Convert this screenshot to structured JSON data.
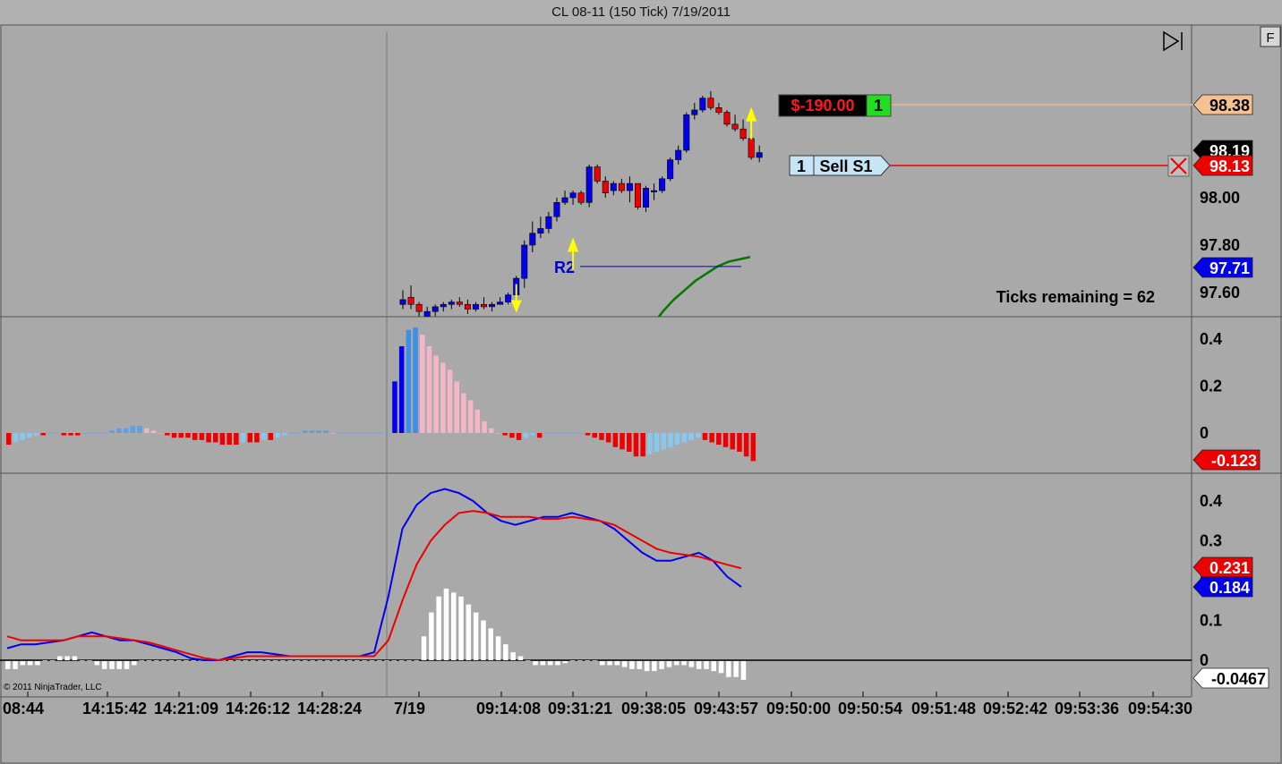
{
  "window": {
    "title": "CL 08-11 (150 Tick)  7/19/2011"
  },
  "toolbar": {
    "f_button": "F"
  },
  "position": {
    "pnl": "$-190.00",
    "qty": "1"
  },
  "order": {
    "qty": "1",
    "label": "Sell S1"
  },
  "status": {
    "ticks_remaining": "Ticks remaining = 62"
  },
  "copyright": "© 2011 NinjaTrader, LLC",
  "colors": {
    "background": "#a9a9a9",
    "bull": "#0000ee",
    "bear": "#ee0000",
    "sma": "#007a00"
  },
  "chart_data": [
    {
      "type": "candlestick",
      "panel": "price",
      "y_ticks": [
        "98.00",
        "97.80",
        "97.60"
      ],
      "ylim": [
        97.49,
        98.5
      ],
      "candles": [
        {
          "o": 97.55,
          "h": 97.61,
          "l": 97.53,
          "c": 97.57
        },
        {
          "o": 97.58,
          "h": 97.63,
          "l": 97.53,
          "c": 97.55
        },
        {
          "o": 97.55,
          "h": 97.56,
          "l": 97.5,
          "c": 97.52
        },
        {
          "o": 97.5,
          "h": 97.54,
          "l": 97.48,
          "c": 97.52
        },
        {
          "o": 97.52,
          "h": 97.55,
          "l": 97.5,
          "c": 97.54
        },
        {
          "o": 97.54,
          "h": 97.56,
          "l": 97.52,
          "c": 97.55
        },
        {
          "o": 97.55,
          "h": 97.57,
          "l": 97.53,
          "c": 97.56
        },
        {
          "o": 97.56,
          "h": 97.58,
          "l": 97.54,
          "c": 97.55
        },
        {
          "o": 97.55,
          "h": 97.57,
          "l": 97.51,
          "c": 97.53
        },
        {
          "o": 97.53,
          "h": 97.56,
          "l": 97.52,
          "c": 97.55
        },
        {
          "o": 97.55,
          "h": 97.58,
          "l": 97.53,
          "c": 97.54
        },
        {
          "o": 97.54,
          "h": 97.56,
          "l": 97.52,
          "c": 97.55
        },
        {
          "o": 97.55,
          "h": 97.58,
          "l": 97.55,
          "c": 97.56
        },
        {
          "o": 97.56,
          "h": 97.6,
          "l": 97.55,
          "c": 97.59
        },
        {
          "o": 97.59,
          "h": 97.67,
          "l": 97.59,
          "c": 97.66
        },
        {
          "o": 97.66,
          "h": 97.82,
          "l": 97.62,
          "c": 97.8
        },
        {
          "o": 97.8,
          "h": 97.9,
          "l": 97.77,
          "c": 97.85
        },
        {
          "o": 97.85,
          "h": 97.92,
          "l": 97.83,
          "c": 97.87
        },
        {
          "o": 97.87,
          "h": 97.94,
          "l": 97.85,
          "c": 97.92
        },
        {
          "o": 97.92,
          "h": 98.0,
          "l": 97.9,
          "c": 97.98
        },
        {
          "o": 97.98,
          "h": 98.03,
          "l": 97.97,
          "c": 98.0
        },
        {
          "o": 98.0,
          "h": 98.03,
          "l": 97.97,
          "c": 98.02
        },
        {
          "o": 98.02,
          "h": 98.03,
          "l": 97.97,
          "c": 97.98
        },
        {
          "o": 97.98,
          "h": 98.14,
          "l": 97.96,
          "c": 98.13
        },
        {
          "o": 98.13,
          "h": 98.14,
          "l": 98.06,
          "c": 98.07
        },
        {
          "o": 98.07,
          "h": 98.09,
          "l": 98.0,
          "c": 98.02
        },
        {
          "o": 98.03,
          "h": 98.07,
          "l": 98.01,
          "c": 98.06
        },
        {
          "o": 98.06,
          "h": 98.08,
          "l": 98.02,
          "c": 98.03
        },
        {
          "o": 98.03,
          "h": 98.09,
          "l": 97.98,
          "c": 98.06
        },
        {
          "o": 98.06,
          "h": 98.06,
          "l": 97.95,
          "c": 97.96
        },
        {
          "o": 97.96,
          "h": 98.05,
          "l": 97.94,
          "c": 98.04
        },
        {
          "o": 98.03,
          "h": 98.06,
          "l": 97.99,
          "c": 98.03
        },
        {
          "o": 98.03,
          "h": 98.09,
          "l": 98.02,
          "c": 98.08
        },
        {
          "o": 98.08,
          "h": 98.17,
          "l": 98.07,
          "c": 98.16
        },
        {
          "o": 98.16,
          "h": 98.22,
          "l": 98.14,
          "c": 98.2
        },
        {
          "o": 98.2,
          "h": 98.36,
          "l": 98.19,
          "c": 98.35
        },
        {
          "o": 98.35,
          "h": 98.4,
          "l": 98.33,
          "c": 98.37
        },
        {
          "o": 98.37,
          "h": 98.43,
          "l": 98.36,
          "c": 98.42
        },
        {
          "o": 98.42,
          "h": 98.45,
          "l": 98.37,
          "c": 98.38
        },
        {
          "o": 98.38,
          "h": 98.4,
          "l": 98.35,
          "c": 98.36
        },
        {
          "o": 98.36,
          "h": 98.37,
          "l": 98.3,
          "c": 98.31
        },
        {
          "o": 98.31,
          "h": 98.35,
          "l": 98.28,
          "c": 98.29
        },
        {
          "o": 98.29,
          "h": 98.33,
          "l": 98.24,
          "c": 98.25
        },
        {
          "o": 98.25,
          "h": 98.27,
          "l": 98.16,
          "c": 98.17
        },
        {
          "o": 98.17,
          "h": 98.22,
          "l": 98.15,
          "c": 98.19
        }
      ],
      "sma": [
        97.4,
        97.46,
        97.52,
        97.57,
        97.61,
        97.65,
        97.68,
        97.71,
        97.73,
        97.74,
        97.75
      ],
      "arrows": [
        {
          "candle": 14,
          "dir": "down",
          "price": 97.53
        },
        {
          "candle": 21,
          "dir": "up",
          "price": 97.81
        },
        {
          "candle": 43,
          "dir": "up",
          "price": 98.36
        }
      ],
      "pivot": {
        "label": "R2",
        "value": 97.71
      },
      "price_tags": [
        {
          "value": "98.38",
          "bg": "#f5c190",
          "fg": "#000"
        },
        {
          "value": "98.19",
          "bg": "#000000",
          "fg": "#ffffff"
        },
        {
          "value": "98.13",
          "bg": "#ee0000",
          "fg": "#ffffff"
        },
        {
          "value": "97.71",
          "bg": "#0000ee",
          "fg": "#ffffff"
        }
      ]
    },
    {
      "type": "bar",
      "panel": "histogram",
      "y_ticks": [
        "0.4",
        "0.2",
        "0"
      ],
      "ylim": [
        -0.15,
        0.45
      ],
      "values": [
        -0.05,
        -0.04,
        -0.03,
        -0.02,
        -0.01,
        -0.01,
        0.0,
        0.0,
        -0.01,
        -0.01,
        -0.01,
        0.0,
        0.0,
        0.0,
        0.0,
        0.01,
        0.02,
        0.02,
        0.03,
        0.03,
        0.02,
        0.01,
        0.0,
        -0.01,
        -0.02,
        -0.02,
        -0.02,
        -0.03,
        -0.03,
        -0.04,
        -0.04,
        -0.05,
        -0.05,
        -0.05,
        -0.04,
        -0.04,
        -0.04,
        -0.03,
        -0.03,
        -0.02,
        -0.01,
        0.0,
        0.0,
        0.01,
        0.01,
        0.01,
        0.01,
        0.0,
        0.0,
        0.0,
        0.0,
        0.0,
        0.0,
        0.0,
        0.0,
        0.0,
        0.22,
        0.37,
        0.44,
        0.45,
        0.42,
        0.37,
        0.33,
        0.3,
        0.27,
        0.22,
        0.17,
        0.14,
        0.1,
        0.05,
        0.02,
        0.0,
        -0.01,
        -0.02,
        -0.03,
        -0.02,
        -0.01,
        -0.02,
        0.0,
        0.0,
        0.0,
        0.0,
        0.0,
        0.0,
        -0.01,
        -0.02,
        -0.03,
        -0.04,
        -0.06,
        -0.07,
        -0.08,
        -0.1,
        -0.1,
        -0.09,
        -0.08,
        -0.07,
        -0.06,
        -0.05,
        -0.04,
        -0.03,
        -0.02,
        -0.03,
        -0.04,
        -0.05,
        -0.06,
        -0.07,
        -0.08,
        -0.1,
        -0.12
      ],
      "last_tag": {
        "value": "-0.123",
        "bg": "#ee0000",
        "fg": "#ffffff"
      }
    },
    {
      "type": "line",
      "panel": "macd",
      "y_ticks": [
        "0.4",
        "0.3",
        "0.2",
        "0.1",
        "0"
      ],
      "ylim": [
        -0.05,
        0.45
      ],
      "series": [
        {
          "color": "#0000ee",
          "values": [
            0.03,
            0.04,
            0.04,
            0.045,
            0.05,
            0.06,
            0.07,
            0.06,
            0.05,
            0.05,
            0.04,
            0.03,
            0.02,
            0.005,
            0.0,
            0.0,
            0.01,
            0.02,
            0.02,
            0.015,
            0.01,
            0.01,
            0.01,
            0.01,
            0.01,
            0.01,
            0.02,
            0.16,
            0.33,
            0.39,
            0.42,
            0.43,
            0.42,
            0.4,
            0.37,
            0.35,
            0.34,
            0.35,
            0.36,
            0.36,
            0.37,
            0.36,
            0.35,
            0.33,
            0.3,
            0.27,
            0.25,
            0.25,
            0.26,
            0.27,
            0.25,
            0.21,
            0.184
          ]
        },
        {
          "color": "#ee0000",
          "values": [
            0.06,
            0.05,
            0.05,
            0.05,
            0.05,
            0.06,
            0.06,
            0.06,
            0.055,
            0.05,
            0.045,
            0.035,
            0.025,
            0.015,
            0.005,
            0.0,
            0.005,
            0.01,
            0.01,
            0.01,
            0.01,
            0.01,
            0.01,
            0.01,
            0.01,
            0.01,
            0.01,
            0.05,
            0.15,
            0.24,
            0.3,
            0.34,
            0.37,
            0.375,
            0.37,
            0.36,
            0.36,
            0.36,
            0.355,
            0.355,
            0.36,
            0.355,
            0.35,
            0.34,
            0.32,
            0.3,
            0.28,
            0.27,
            0.265,
            0.26,
            0.25,
            0.24,
            0.231
          ]
        }
      ],
      "histogram": [
        -0.02,
        -0.02,
        -0.01,
        -0.01,
        -0.01,
        0.0,
        0.0,
        0.01,
        0.01,
        0.01,
        0.0,
        0.0,
        -0.01,
        -0.02,
        -0.02,
        -0.02,
        -0.02,
        -0.01,
        0.0,
        0.0,
        0.0,
        0.0,
        0.0,
        0.0,
        0.0,
        0.0,
        0.0,
        0.0,
        0.0,
        0.0,
        0.0,
        0.0,
        0.0,
        0.0,
        0.0,
        0.0,
        0.0,
        0.0,
        0.0,
        0.0,
        0.0,
        0.0,
        0.0,
        0.0,
        0.0,
        0.0,
        0.0,
        0.0,
        0.0,
        0.0,
        0.0,
        0.0,
        0.0,
        0.0,
        0.0,
        0.0,
        0.06,
        0.12,
        0.16,
        0.18,
        0.17,
        0.16,
        0.14,
        0.12,
        0.1,
        0.08,
        0.06,
        0.04,
        0.02,
        0.01,
        0.0,
        -0.01,
        -0.01,
        -0.01,
        -0.01,
        -0.005,
        0.0,
        0.0,
        0.0,
        0.0,
        -0.01,
        -0.01,
        -0.01,
        -0.015,
        -0.02,
        -0.02,
        -0.025,
        -0.025,
        -0.02,
        -0.015,
        -0.01,
        -0.01,
        -0.015,
        -0.02,
        -0.02,
        -0.025,
        -0.03,
        -0.04,
        -0.04,
        -0.047
      ],
      "tags": [
        {
          "value": "0.231",
          "bg": "#ee0000",
          "fg": "#ffffff"
        },
        {
          "value": "0.184",
          "bg": "#0000ee",
          "fg": "#ffffff"
        },
        {
          "value": "-0.0467",
          "bg": "#ffffff",
          "fg": "#000000"
        }
      ]
    },
    {
      "type": "axis",
      "panel": "time",
      "labels": [
        "08:44",
        "14:15:42",
        "14:21:09",
        "14:26:12",
        "14:28:24",
        "7/19",
        "09:14:08",
        "09:31:21",
        "09:38:05",
        "09:43:57",
        "09:50:00",
        "09:50:54",
        "09:51:48",
        "09:52:42",
        "09:53:36",
        "09:54:30"
      ]
    }
  ]
}
